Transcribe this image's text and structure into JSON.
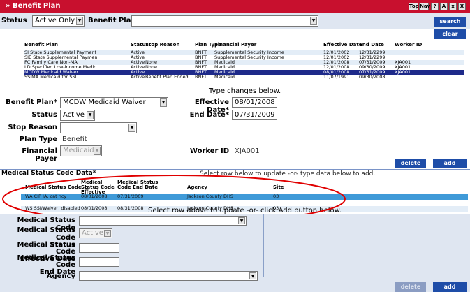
{
  "window": {
    "title": "» Benefit Plan",
    "buttons": [
      "Top",
      "Nav",
      "?",
      "A",
      "x",
      "X"
    ]
  },
  "filters": {
    "status_label": "Status",
    "status_value": "Active Only",
    "benefit_plan_label": "Benefit Plan",
    "benefit_plan_value": "",
    "search_label": "search",
    "clear_label": "clear"
  },
  "plan_table": {
    "headers": [
      "Benefit Plan",
      "Status",
      "Stop Reason",
      "Plan Type",
      "Financial Payer",
      "Effective Date",
      "End Date",
      "Worker ID"
    ],
    "rows": [
      [
        "SI State Supplemental Payment",
        "Active",
        "",
        "BNFT",
        "Supplemental Security Income",
        "12/01/2002",
        "12/31/2299",
        ""
      ],
      [
        "SIE State Supplemental Paymen",
        "Active",
        "",
        "BNFT",
        "Supplemental Security Income",
        "12/01/2002",
        "12/31/2299",
        ""
      ],
      [
        "FC Family Care Non-MA",
        "Active",
        "None",
        "BNFT",
        "Medicaid",
        "12/01/2008",
        "07/31/2009",
        "XJA001"
      ],
      [
        "LD Specified Low-income Medic",
        "Active",
        "None",
        "BNFT",
        "Medicaid",
        "12/01/2008",
        "09/30/2009",
        "XJA001"
      ],
      [
        "MCDW Medicaid Waiver",
        "Active",
        "",
        "BNFT",
        "Medicaid",
        "08/01/2008",
        "07/31/2009",
        "XJA001"
      ],
      [
        "SSIMA Medicaid for SSI",
        "Active",
        "Benefit Plan Ended",
        "BNFT",
        "Medicaid",
        "11/07/1991",
        "09/30/2008",
        ""
      ]
    ],
    "note": "Type changes below."
  },
  "plan_form": {
    "benefit_plan_label": "Benefit Plan*",
    "benefit_plan_value": "MCDW Medicaid Waiver",
    "status_label": "Status",
    "status_value": "Active",
    "stop_reason_label": "Stop Reason",
    "stop_reason_value": "",
    "plan_type_label": "Plan Type",
    "plan_type_value": "Benefit",
    "financial_payer_label": "Financial Payer",
    "financial_payer_value": "Medicaid",
    "effective_date_label": "Effective Date*",
    "effective_date_value": "08/01/2008",
    "end_date_label": "End Date*",
    "end_date_value": "07/31/2009",
    "worker_id_label": "Worker ID",
    "worker_id_value": "XJA001",
    "delete_label": "delete",
    "add_label": "add"
  },
  "medical_status": {
    "section_label": "Medical Status Code Data*",
    "section_hint": "Select row below to update -or- type data below to add.",
    "headers": [
      "Medical Status Code",
      "Medical Status Code Effective Date",
      "Medical Status Code End Date",
      "Agency",
      "Site"
    ],
    "rows": [
      [
        "WA CIP IA, cat ncy",
        "08/01/2008",
        "07/31/2009",
        "Jackson County DHS",
        "03"
      ],
      [
        "WS SSI/Waiver, disabled",
        "08/01/2008",
        "08/31/2008",
        "Jackson County DHS",
        "03"
      ]
    ],
    "footer_hint": "Select row above to update -or- click Add button below."
  },
  "med_form": {
    "code_label": "Medical Status Code",
    "status_label_1": "Medical Status Code",
    "status_label_2": "Status",
    "status_value": "Active",
    "eff_label_1": "Medical Status Code",
    "eff_label_2": "Effective Date",
    "end_label_1": "Medical Status Code",
    "end_label_2": "End Date",
    "agency_label": "Agency",
    "delete_label": "delete",
    "add_label": "add"
  },
  "colors": {
    "title_bar": "#c8102e",
    "panel_bg": "#dfe6f1",
    "selected_row": "#1e2a8a",
    "button_blue": "#1e4da8",
    "annotation_oval": "#e00000"
  }
}
